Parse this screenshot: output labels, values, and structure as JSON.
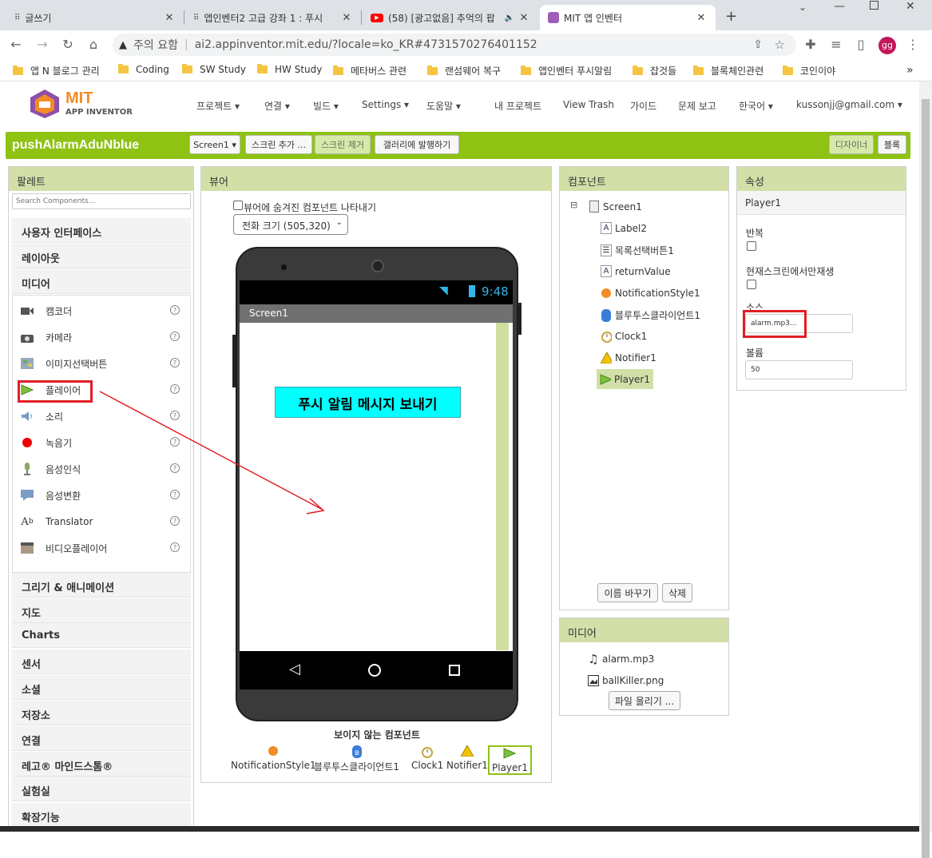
{
  "browser": {
    "tabs": [
      {
        "title": "글쓰기",
        "close": "✕"
      },
      {
        "title": "앱인벤터2 고급 강좌 1 : 푸시",
        "close": "✕"
      },
      {
        "title": "(58) [광고없음] 추억의 팝",
        "close": "✕"
      },
      {
        "title": "MIT 앱 인벤터",
        "close": "✕"
      }
    ],
    "new_tab": "+",
    "address_warning": "주의 요함",
    "url": "ai2.appinventor.mit.edu/?locale=ko_KR#4731570276401152",
    "profile_initials": "gg",
    "bookmarks": [
      "앱 N 블로그 관리",
      "Coding",
      "SW Study",
      "HW Study",
      "메타버스 관련",
      "랜섬웨어 복구",
      "앱인벤터 푸시알림",
      "잡것들",
      "블록체인관련",
      "코인이야"
    ],
    "bookmarks_more": "»"
  },
  "app": {
    "logo_title": "MIT",
    "logo_sub": "APP INVENTOR",
    "menus": [
      "프로젝트 ▾",
      "연결 ▾",
      "빌드 ▾",
      "Settings ▾",
      "도움말 ▾"
    ],
    "links": [
      "내 프로젝트",
      "View Trash",
      "가이드",
      "문제 보고",
      "한국어 ▾",
      "kussonjj@gmail.com ▾"
    ]
  },
  "toolbar": {
    "project_name": "pushAlarmAduNblue",
    "screen_select": "Screen1 ▾",
    "add_screen": "스크린 추가 ...",
    "remove_screen": "스크린 제거",
    "publish_gallery": "갤러리에 발행하기",
    "designer": "디자이너",
    "blocks": "블록"
  },
  "palette": {
    "title": "팔레트",
    "search_placeholder": "Search Components...",
    "cat_ui": "사용자 인터페이스",
    "cat_layout": "레이아웃",
    "cat_media": "미디어",
    "media_items": [
      {
        "label": "캠코더",
        "icon": "camcorder-icon"
      },
      {
        "label": "카메라",
        "icon": "camera-icon"
      },
      {
        "label": "이미지선택버튼",
        "icon": "image-picker-icon"
      },
      {
        "label": "플레이어",
        "icon": "player-icon"
      },
      {
        "label": "소리",
        "icon": "sound-icon"
      },
      {
        "label": "녹음기",
        "icon": "recorder-icon"
      },
      {
        "label": "음성인식",
        "icon": "speech-recognizer-icon"
      },
      {
        "label": "음성변환",
        "icon": "text-to-speech-icon"
      },
      {
        "label": "Translator",
        "icon": "translator-icon"
      },
      {
        "label": "비디오플레이어",
        "icon": "video-player-icon"
      }
    ],
    "help": "?",
    "categories_below": [
      "그리기 & 애니메이션",
      "지도",
      "Charts",
      "센서",
      "소셜",
      "저장소",
      "연결",
      "레고® 마인드스톰®",
      "실험실",
      "확장기능"
    ]
  },
  "viewer": {
    "title": "뷰어",
    "show_hidden": "뷰어에 숨겨진 컴포넌트 나타내기",
    "phone_size": "전화 크기 (505,320)",
    "status_time": "9:48",
    "screen_title": "Screen1",
    "label_text": "푸시 알림 메시지 보내기",
    "nonvisible_title": "보이지 않는 컴포넌트",
    "nonvisible": [
      "NotificationStyle1",
      "블루투스클라이언트1",
      "Clock1",
      "Notifier1",
      "Player1"
    ],
    "label_bg": "#00ffff"
  },
  "components": {
    "title": "컴포넌트",
    "collapse": "⊟",
    "root": "Screen1",
    "items": [
      "Label2",
      "목록선택버튼1",
      "returnValue",
      "NotificationStyle1",
      "블루투스클라이언트1",
      "Clock1",
      "Notifier1",
      "Player1"
    ],
    "rename": "이름 바꾸기",
    "delete": "삭제"
  },
  "media": {
    "title": "미디어",
    "files": [
      "alarm.mp3",
      "ballKiller.png"
    ],
    "upload": "파일 올리기 ..."
  },
  "properties": {
    "title": "속성",
    "component": "Player1",
    "loop_label": "반복",
    "play_only_foreground_label": "현재스크린에서만재생",
    "source_label": "소스",
    "source_value": "alarm.mp3...",
    "volume_label": "볼륨",
    "volume_value": "50"
  },
  "colors": {
    "green_bar": "#8ec213",
    "panel_header": "#d2e0a8",
    "annotation_red": "#e01e25"
  }
}
